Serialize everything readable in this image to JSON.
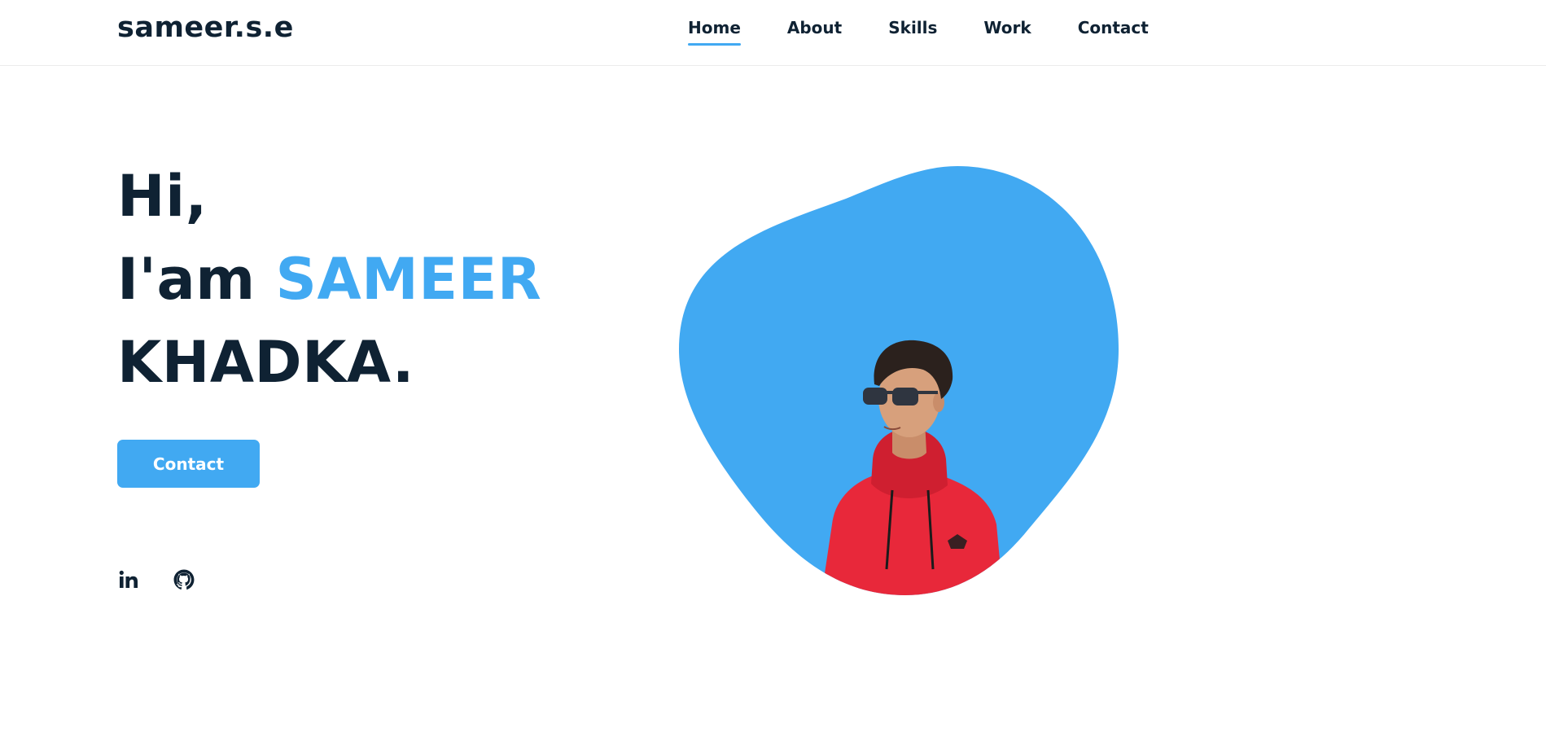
{
  "header": {
    "logo": "sameer.s.e",
    "nav": [
      {
        "label": "Home",
        "active": true
      },
      {
        "label": "About",
        "active": false
      },
      {
        "label": "Skills",
        "active": false
      },
      {
        "label": "Work",
        "active": false
      },
      {
        "label": "Contact",
        "active": false
      }
    ]
  },
  "hero": {
    "line1": "Hi,",
    "line2_prefix": "I'am ",
    "line2_accent": "SAMEER",
    "line3": "KHADKA.",
    "button_label": "Contact"
  },
  "socials": [
    {
      "icon": "linkedin-icon"
    },
    {
      "icon": "github-icon"
    }
  ],
  "colors": {
    "accent": "#41a9f2",
    "text": "#0f2233",
    "hoodie": "#e8283a"
  }
}
